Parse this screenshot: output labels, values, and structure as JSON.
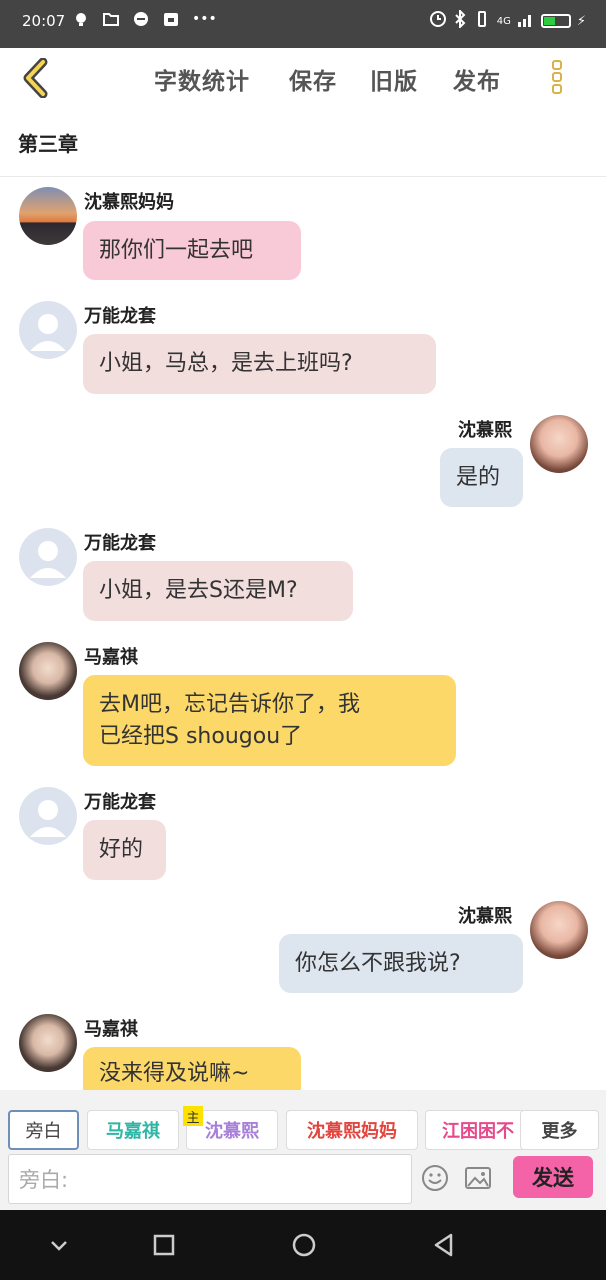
{
  "status": {
    "time": "20:07",
    "network": "4G"
  },
  "header": {
    "word_count": "字数统计",
    "save": "保存",
    "old_version": "旧版",
    "publish": "发布"
  },
  "chapter_title": "第三章",
  "messages": [
    {
      "sender": "沈慕熙妈妈",
      "text": "那你们一起去吧",
      "side": "left",
      "color": "#f8c9d6"
    },
    {
      "sender": "万能龙套",
      "text": "小姐，马总，是去上班吗?",
      "side": "left",
      "color": "#f3dede"
    },
    {
      "sender": "沈慕熙",
      "text": "是的",
      "side": "right",
      "color": "#dde5ef"
    },
    {
      "sender": "万能龙套",
      "text": "小姐，是去S还是M?",
      "side": "left",
      "color": "#f3dede"
    },
    {
      "sender": "马嘉祺",
      "text_line1": "去M吧，忘记告诉你了，我",
      "text_line2": "已经把S shougou了",
      "side": "left",
      "color": "#fbd868"
    },
    {
      "sender": "万能龙套",
      "text": "好的",
      "side": "left",
      "color": "#f3dede"
    },
    {
      "sender": "沈慕熙",
      "text": "你怎么不跟我说?",
      "side": "right",
      "color": "#dde5ef"
    },
    {
      "sender": "马嘉祺",
      "text": "没来得及说嘛~",
      "side": "left",
      "color": "#fbd868"
    }
  ],
  "roles": {
    "narration": "旁白",
    "role1": "马嘉祺",
    "main_badge": "主",
    "role2": "沈慕熙",
    "role3": "沈慕熙妈妈",
    "role4": "江困困不",
    "more": "更多"
  },
  "role_colors": {
    "role1": "#2fb5a4",
    "role2": "#a87fd9",
    "role3": "#e2463e",
    "role4": "#e64a8c"
  },
  "input": {
    "placeholder": "旁白:"
  },
  "send_label": "发送"
}
